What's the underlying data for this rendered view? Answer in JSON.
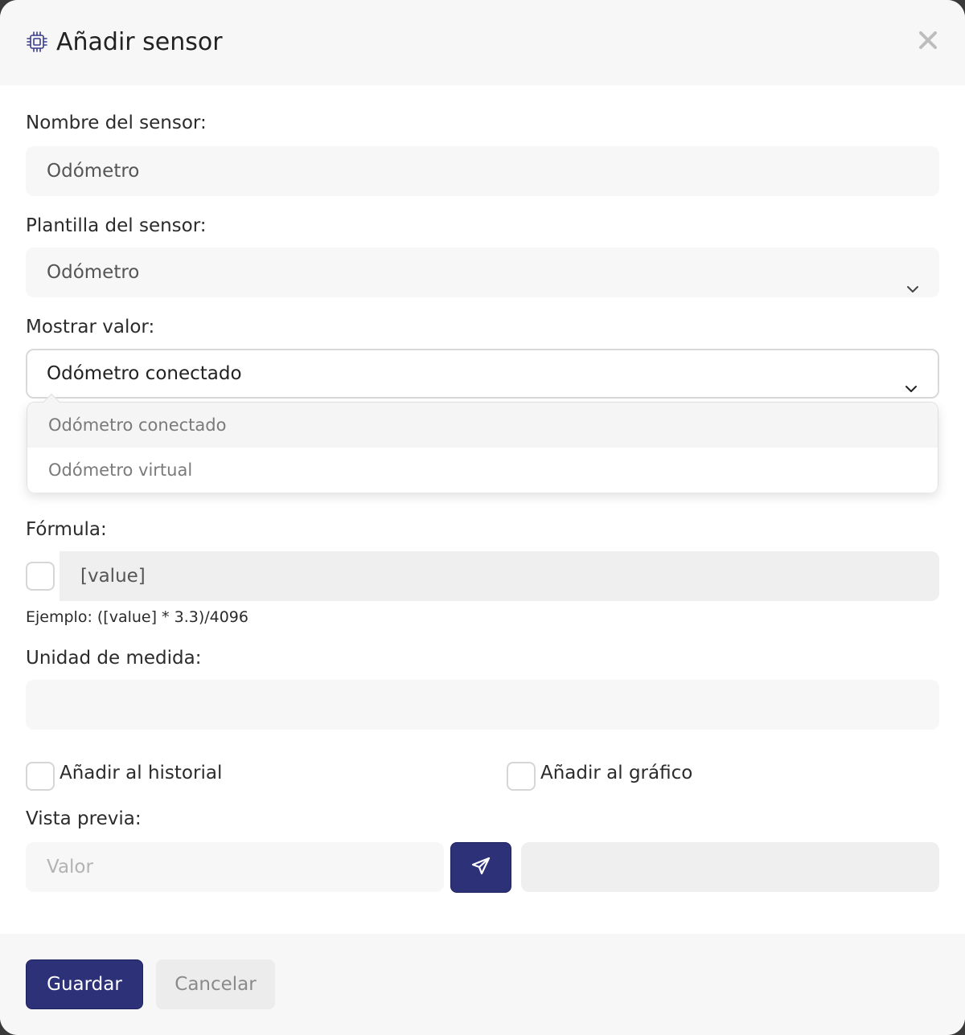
{
  "dialog": {
    "title": "Añadir sensor",
    "icon": "chip-icon",
    "close_icon": "close-icon"
  },
  "form": {
    "sensor_name": {
      "label": "Nombre del sensor:",
      "value": "Odómetro"
    },
    "sensor_template": {
      "label": "Plantilla del sensor:",
      "selected": "Odómetro"
    },
    "show_value": {
      "label": "Mostrar valor:",
      "selected": "Odómetro conectado",
      "options": [
        "Odómetro conectado",
        "Odómetro virtual"
      ]
    },
    "formula": {
      "label": "Fórmula:",
      "value": "[value]",
      "enabled": false,
      "hint": "Ejemplo: ([value] * 3.3)/4096"
    },
    "unit": {
      "label": "Unidad de medida:",
      "value": ""
    },
    "add_to_history": {
      "label": "Añadir al historial",
      "checked": false
    },
    "add_to_chart": {
      "label": "Añadir al gráfico",
      "checked": false
    },
    "preview": {
      "label": "Vista previa:",
      "placeholder": "Valor",
      "send_icon": "paper-plane-icon",
      "result": ""
    }
  },
  "footer": {
    "save_label": "Guardar",
    "cancel_label": "Cancelar"
  },
  "colors": {
    "primary": "#2c3178",
    "icon_accent": "#3a3f8f"
  }
}
